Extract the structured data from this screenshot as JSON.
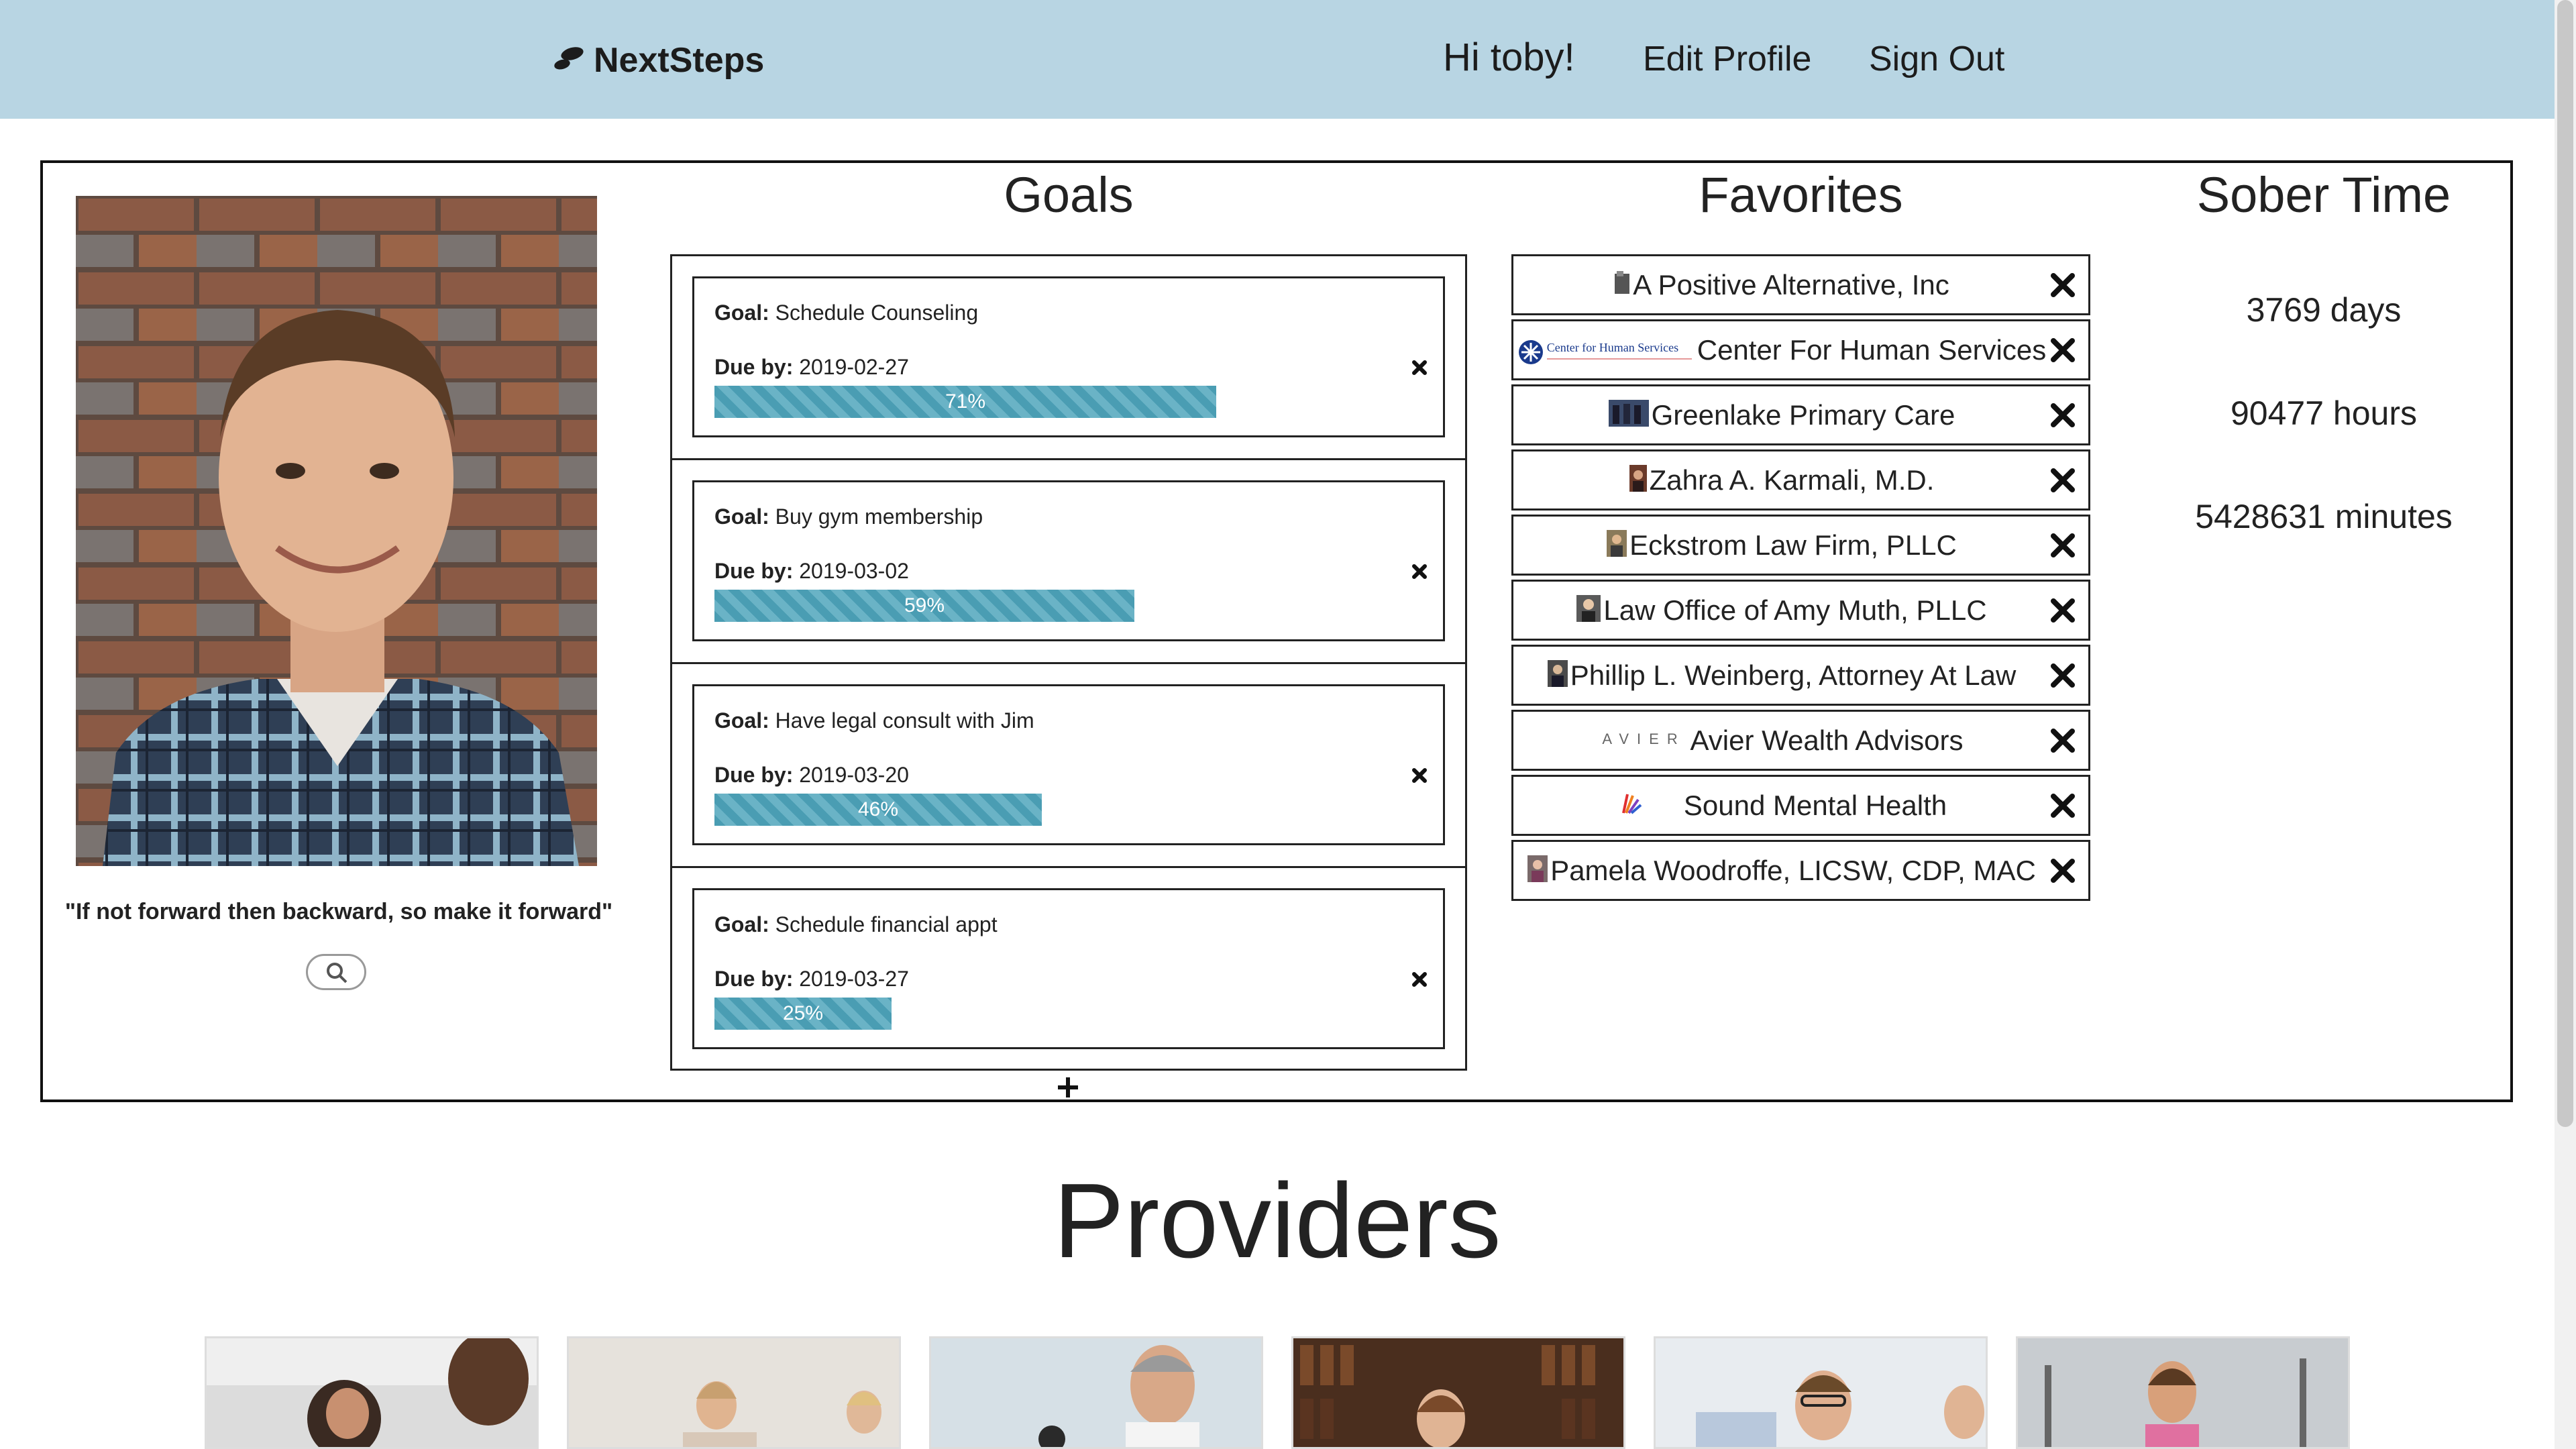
{
  "navbar": {
    "brand": "NextSteps",
    "greeting": "Hi toby!",
    "edit_profile": "Edit Profile",
    "sign_out": "Sign Out"
  },
  "profile": {
    "quote": "\"If not forward then backward, so make it forward\""
  },
  "goals": {
    "title": "Goals",
    "goal_label": "Goal:",
    "due_label": "Due by:",
    "items": [
      {
        "goal": "Schedule Counseling",
        "due": "2019-02-27",
        "progress_text": "71%",
        "progress": 71
      },
      {
        "goal": "Buy gym membership",
        "due": "2019-03-02",
        "progress_text": "59%",
        "progress": 59
      },
      {
        "goal": "Have legal consult with Jim",
        "due": "2019-03-20",
        "progress_text": "46%",
        "progress": 46
      },
      {
        "goal": "Schedule financial appt",
        "due": "2019-03-27",
        "progress_text": "25%",
        "progress": 25
      }
    ]
  },
  "favorites": {
    "title": "Favorites",
    "items": [
      {
        "name": "A Positive Alternative, Inc"
      },
      {
        "name": "Center For Human Services",
        "logo_text": "Center for Human Services"
      },
      {
        "name": "Greenlake Primary Care"
      },
      {
        "name": "Zahra A. Karmali, M.D."
      },
      {
        "name": "Eckstrom Law Firm, PLLC"
      },
      {
        "name": "Law Office of Amy Muth, PLLC"
      },
      {
        "name": "Phillip L. Weinberg, Attorney At Law"
      },
      {
        "name": "Avier Wealth Advisors",
        "logo_text": "AVIER"
      },
      {
        "name": "Sound Mental Health"
      },
      {
        "name": "Pamela Woodroffe, LICSW, CDP, MAC"
      }
    ]
  },
  "sober": {
    "title": "Sober Time",
    "days": "3769 days",
    "hours": "90477 hours",
    "minutes": "5428631 minutes"
  },
  "providers": {
    "title": "Providers"
  },
  "colors": {
    "navbar": "#b8d5e3",
    "progress": "#4a9db3"
  }
}
